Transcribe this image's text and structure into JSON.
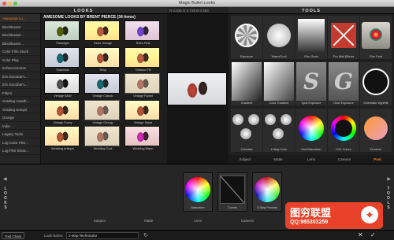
{
  "window": {
    "title": "Magic Bullet Looks"
  },
  "looks_panel": {
    "title": "LOOKS",
    "collection_title": "AWESOME LOOKS BY BRENT PIERCE (34 items)",
    "categories": [
      {
        "label": "Awesome Lo...",
        "active": true
      },
      {
        "label": "Blockbuster"
      },
      {
        "label": "Blockbuster..."
      },
      {
        "label": "Blockbuster..."
      },
      {
        "label": "Color Film Stock"
      },
      {
        "label": "Color Play"
      },
      {
        "label": "Enhancements"
      },
      {
        "label": "Eric Escobar's..."
      },
      {
        "label": "Eric Escobar's..."
      },
      {
        "label": "Filters"
      },
      {
        "label": "Grading Headb..."
      },
      {
        "label": "Grading Setups"
      },
      {
        "label": "Grunge"
      },
      {
        "label": "Indie"
      },
      {
        "label": "Legacy Tools"
      },
      {
        "label": "Log Color Film..."
      },
      {
        "label": "Log Film Show..."
      }
    ],
    "looks": [
      {
        "label": "Paradigm",
        "style": "green"
      },
      {
        "label": "Retro Orange",
        "style": "orange"
      },
      {
        "label": "Retro Pink",
        "style": "purple"
      },
      {
        "label": "Superstar",
        "style": "blue"
      },
      {
        "label": "Tinsy",
        "style": "warm"
      },
      {
        "label": "Tobacco Fill",
        "style": "orange"
      },
      {
        "label": "Vintage B&W",
        "style": "bw"
      },
      {
        "label": "Vintage Classic",
        "style": "blue"
      },
      {
        "label": "Vintage Faded",
        "style": "faded"
      },
      {
        "label": "Vintage Fuzzy",
        "style": "warm"
      },
      {
        "label": "Vintage Grungy",
        "style": "faded"
      },
      {
        "label": "Vintage Sepia",
        "style": "warm"
      },
      {
        "label": "Wedding Antique",
        "style": "warm"
      },
      {
        "label": "Wedding Cool",
        "style": "faded"
      },
      {
        "label": "Wedding Warm",
        "style": "pink"
      }
    ]
  },
  "readout": {
    "text": "R 0.835  G 0.738  B 0.683"
  },
  "tools_panel": {
    "title": "TOOLS",
    "tools": [
      {
        "label": "Exposure",
        "shape": "aperture"
      },
      {
        "label": "Warm/Cool",
        "shape": "halfcut"
      },
      {
        "label": "Film Grain",
        "shape": "grad"
      },
      {
        "label": "Pro Mist Effects",
        "shape": "mist"
      },
      {
        "label": "Film Print",
        "shape": "film"
      },
      {
        "label": "Gradient",
        "shape": "vgrad"
      },
      {
        "label": "Color Gradient",
        "shape": "colorgrad"
      },
      {
        "label": "Spot Exposure",
        "shape": "sletter",
        "glyph": "S"
      },
      {
        "label": "Grad Exposure",
        "shape": "sletter",
        "glyph": "G"
      },
      {
        "label": "Cinematic Vignette",
        "shape": "ring"
      },
      {
        "label": "Colorista",
        "shape": "dots"
      },
      {
        "label": "4-Way Color",
        "shape": "dots"
      },
      {
        "label": "Hue/Saturation",
        "shape": "wheel"
      },
      {
        "label": "HSL Colors",
        "shape": "wheelring"
      },
      {
        "label": "Duotone",
        "shape": "duo"
      }
    ],
    "tabs": [
      {
        "label": "Subject"
      },
      {
        "label": "Matte"
      },
      {
        "label": "Lens"
      },
      {
        "label": "Camera"
      },
      {
        "label": "Post",
        "active": true
      }
    ]
  },
  "tool_chain": {
    "side_label": "LOOKS",
    "side_label_right": "TOOLS",
    "tools": [
      {
        "label": "Saturation"
      },
      {
        "label": "Curves"
      },
      {
        "label": "3-Strip Process"
      }
    ],
    "stages": [
      {
        "label": "Subject"
      },
      {
        "label": "Matte"
      },
      {
        "label": "Lens"
      },
      {
        "label": "Camera"
      }
    ]
  },
  "statusbar": {
    "tool_chain_label": "Tool Chain",
    "look_name_label": "Look Name:",
    "look_name_value": "2-strip Technicolor"
  },
  "watermark": {
    "title": "图穷联盟",
    "subtitle": "QQ:985303259"
  },
  "colors": {
    "accent": "#ff7a1a",
    "watermark_red": "#e8432a"
  }
}
